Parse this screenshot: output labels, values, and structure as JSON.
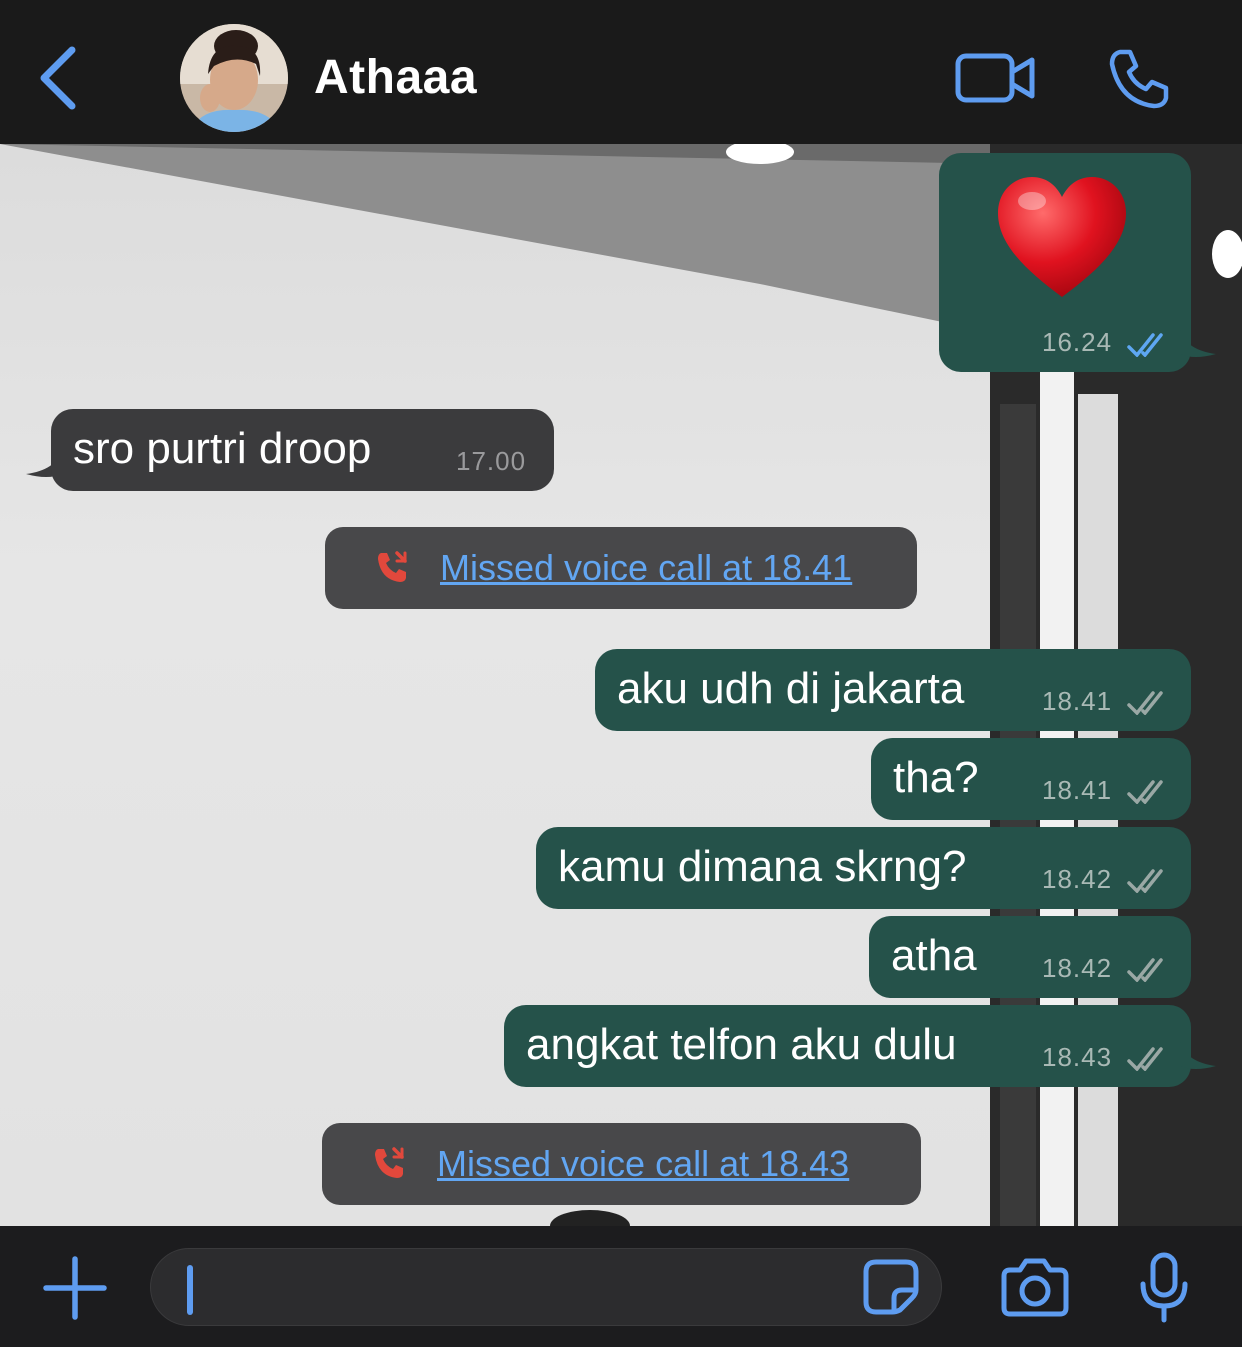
{
  "header": {
    "contact_name": "Athaaa",
    "icons": {
      "back": "chevron-left-icon",
      "video": "video-camera-icon",
      "call": "phone-icon"
    },
    "accent_color": "#5e9cf0"
  },
  "messages": [
    {
      "type": "outgoing",
      "text": "",
      "emoji": "heart",
      "time": "16.24",
      "status": "read"
    },
    {
      "type": "incoming",
      "text": "sro purtri droop",
      "time": "17.00"
    },
    {
      "type": "missed_call",
      "text": "Missed voice call at 18.41"
    },
    {
      "type": "outgoing",
      "text": "aku udh di jakarta",
      "time": "18.41",
      "status": "delivered"
    },
    {
      "type": "outgoing",
      "text": "tha?",
      "time": "18.41",
      "status": "delivered"
    },
    {
      "type": "outgoing",
      "text": "kamu dimana skrng?",
      "time": "18.42",
      "status": "delivered"
    },
    {
      "type": "outgoing",
      "text": "atha",
      "time": "18.42",
      "status": "delivered"
    },
    {
      "type": "outgoing",
      "text": "angkat telfon aku dulu",
      "time": "18.43",
      "status": "delivered"
    },
    {
      "type": "missed_call",
      "text": "Missed voice call at 18.43"
    }
  ],
  "input_bar": {
    "placeholder": "",
    "icons": {
      "add": "plus-icon",
      "sticker": "sticker-icon",
      "camera": "camera-icon",
      "mic": "microphone-icon"
    }
  },
  "colors": {
    "outgoing_bubble": "#25524a",
    "incoming_bubble": "#3b3b3d",
    "missed_call_bubble": "#48484a",
    "missed_call_icon": "#e2483c",
    "read_ticks": "#5ea7f2"
  }
}
